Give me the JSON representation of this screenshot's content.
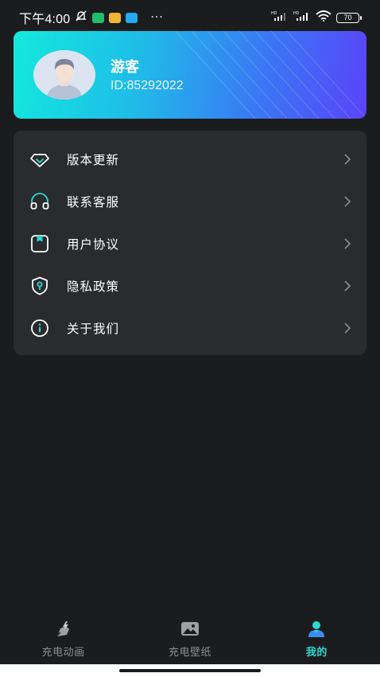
{
  "status_bar": {
    "time": "下午4:00",
    "more": "···",
    "battery": "70",
    "signal_tag": "HD"
  },
  "profile": {
    "name": "游客",
    "id": "ID:85292022"
  },
  "menu": {
    "items": [
      {
        "label": "版本更新",
        "icon": "diamond-icon"
      },
      {
        "label": "联系客服",
        "icon": "headset-icon"
      },
      {
        "label": "用户协议",
        "icon": "agreement-icon"
      },
      {
        "label": "隐私政策",
        "icon": "shield-icon"
      },
      {
        "label": "关于我们",
        "icon": "info-icon"
      }
    ]
  },
  "bottom_nav": {
    "tabs": [
      {
        "label": "充电动画",
        "icon": "lightning-pen-icon",
        "active": false
      },
      {
        "label": "充电壁纸",
        "icon": "wallpaper-icon",
        "active": false
      },
      {
        "label": "我的",
        "icon": "user-icon",
        "active": true
      }
    ]
  },
  "colors": {
    "background": "#1b1c1e",
    "panel": "#2a2b2d",
    "accent": "#2bd9d1",
    "card_gradient_start": "#13e9dd",
    "card_gradient_end": "#5a43fa"
  }
}
